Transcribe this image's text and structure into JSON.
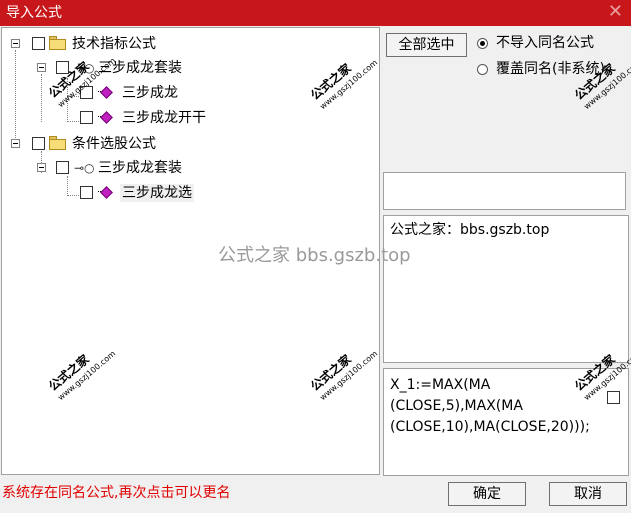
{
  "window": {
    "title": "导入公式",
    "close_glyph": "✕"
  },
  "tree": {
    "group1": {
      "label": "技术指标公式",
      "child": {
        "label": "三步成龙套装",
        "items": [
          "三步成龙",
          "三步成龙开干"
        ]
      }
    },
    "group2": {
      "label": "条件选股公式",
      "child": {
        "label": "三步成龙套装",
        "items": [
          "三步成龙选"
        ]
      }
    }
  },
  "right": {
    "select_all_label": "全部选中",
    "option_skip_label": "不导入同名公式",
    "option_overwrite_label": "覆盖同名(非系统)",
    "selected_option": "skip",
    "description": "公式之家：bbs.gszb.top",
    "code": "X_1:=MAX(MA\n(CLOSE,5),MAX(MA\n(CLOSE,10),MA(CLOSE,20)));"
  },
  "status_message": "系统存在同名公式,再次点击可以更名",
  "buttons": {
    "ok": "确定",
    "cancel": "取消"
  },
  "watermarks": {
    "corner_text": "公式之家",
    "corner_url": "www.gszj100.com",
    "center_text": "公式之家 bbs.gszb.top"
  }
}
